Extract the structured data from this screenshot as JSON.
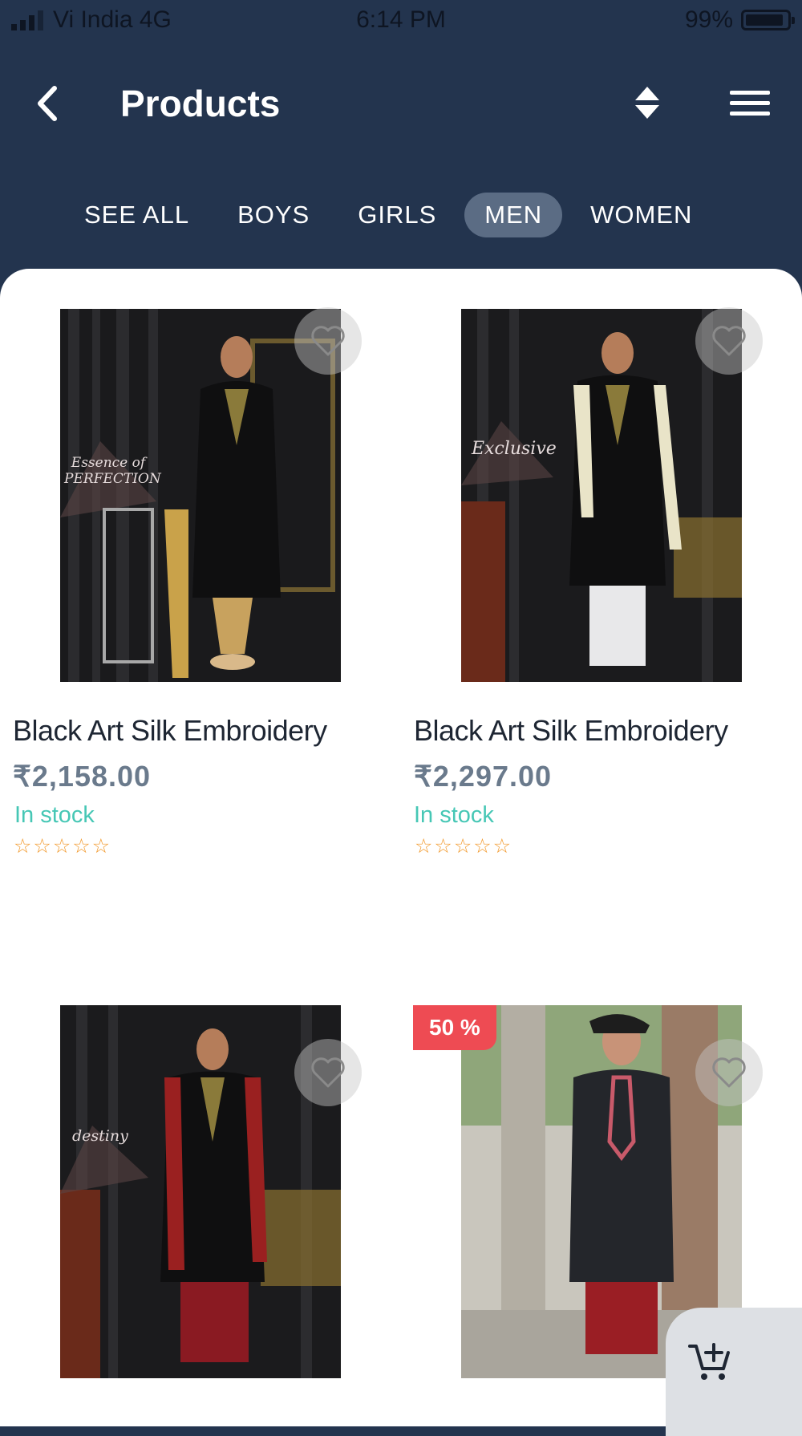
{
  "status_bar": {
    "carrier": "Vi India 4G",
    "time": "6:14 PM",
    "battery": "99%"
  },
  "header": {
    "title": "Products",
    "back_icon": "chevron-left-icon",
    "sort_icon": "sort-icon",
    "menu_icon": "hamburger-menu-icon"
  },
  "tabs": [
    {
      "label": "SEE ALL",
      "active": false
    },
    {
      "label": "BOYS",
      "active": false
    },
    {
      "label": "GIRLS",
      "active": false
    },
    {
      "label": "MEN",
      "active": true
    },
    {
      "label": "WOMEN",
      "active": false
    }
  ],
  "products": [
    {
      "name": "Black Art Silk Embroidery",
      "price": "₹2,158.00",
      "stock": "In stock",
      "rating": "☆☆☆☆☆",
      "rating_value": 0,
      "discount": "",
      "watermark": "Essence of PERFECTION"
    },
    {
      "name": "Black Art Silk Embroidery",
      "price": "₹2,297.00",
      "stock": "In stock",
      "rating": "☆☆☆☆☆",
      "rating_value": 0,
      "discount": "",
      "watermark": "Exclusive"
    },
    {
      "name": "",
      "price": "",
      "stock": "",
      "rating": "",
      "discount": "",
      "watermark": "destiny"
    },
    {
      "name": "",
      "price": "",
      "stock": "",
      "rating": "",
      "discount": "50 %",
      "watermark": ""
    }
  ],
  "cart_fab": {
    "icon": "add-to-cart-icon"
  },
  "colors": {
    "header_bg": "#23344e",
    "active_tab": "#5b6c84",
    "in_stock": "#46c7b5",
    "stars": "#f29a2e",
    "discount": "#ee4b53",
    "price": "#6a7a8c"
  }
}
